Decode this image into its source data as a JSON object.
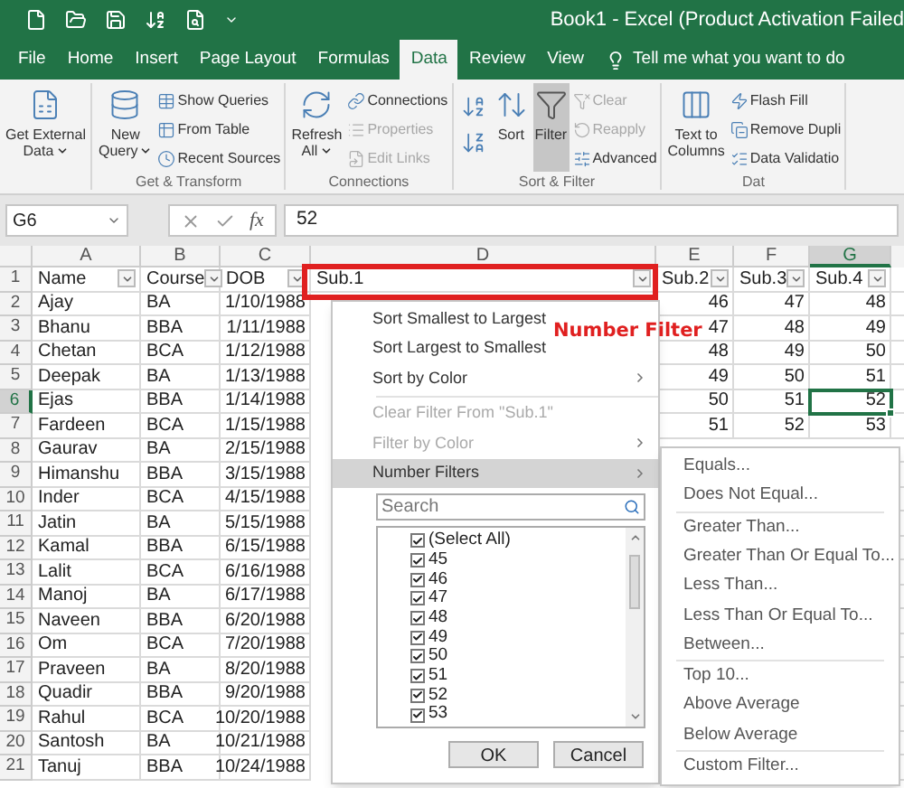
{
  "title_bar": {
    "title": "Book1 - Excel (Product Activation Failed"
  },
  "menu_tabs": [
    {
      "label": "File",
      "selected": false
    },
    {
      "label": "Home",
      "selected": false
    },
    {
      "label": "Insert",
      "selected": false
    },
    {
      "label": "Page Layout",
      "selected": false
    },
    {
      "label": "Formulas",
      "selected": false
    },
    {
      "label": "Data",
      "selected": true
    },
    {
      "label": "Review",
      "selected": false
    },
    {
      "label": "View",
      "selected": false
    }
  ],
  "tell_me": "Tell me what you want to do",
  "ribbon_groups": [
    {
      "items": [
        {
          "kind": "large",
          "lines": [
            "Get External",
            "Data"
          ],
          "dropdown": true,
          "disabled": false,
          "selected": false
        }
      ]
    },
    {
      "label": "Get & Transform",
      "items": [
        {
          "kind": "large",
          "lines": [
            "New",
            "Query"
          ],
          "dropdown": true,
          "disabled": false,
          "selected": false
        },
        {
          "kind": "small",
          "label": "Show Queries",
          "disabled": false
        },
        {
          "kind": "small",
          "label": "From Table",
          "disabled": false
        },
        {
          "kind": "small",
          "label": "Recent Sources",
          "disabled": false
        }
      ]
    },
    {
      "label": "Connections",
      "items": [
        {
          "kind": "large",
          "lines": [
            "Refresh",
            "All"
          ],
          "dropdown": true,
          "disabled": false,
          "selected": false
        },
        {
          "kind": "small",
          "label": "Connections",
          "disabled": false
        },
        {
          "kind": "small",
          "label": "Properties",
          "disabled": true
        },
        {
          "kind": "small",
          "label": "Edit Links",
          "disabled": true
        }
      ]
    },
    {
      "label": "Sort & Filter",
      "items": [
        {
          "kind": "icons"
        },
        {
          "kind": "large",
          "lines": [
            "Sort"
          ],
          "dropdown": false,
          "disabled": false,
          "selected": false
        },
        {
          "kind": "large",
          "lines": [
            "Filter"
          ],
          "dropdown": false,
          "disabled": false,
          "selected": true
        },
        {
          "kind": "small",
          "label": "Clear",
          "disabled": true
        },
        {
          "kind": "small",
          "label": "Reapply",
          "disabled": true
        },
        {
          "kind": "small",
          "label": "Advanced",
          "disabled": false
        }
      ]
    },
    {
      "label": "Dat",
      "items": [
        {
          "kind": "large",
          "lines": [
            "Text to",
            "Columns"
          ],
          "dropdown": false,
          "disabled": false,
          "selected": false
        },
        {
          "kind": "small",
          "label": "Flash Fill",
          "disabled": false
        },
        {
          "kind": "small",
          "label": "Remove Dupli",
          "disabled": false
        },
        {
          "kind": "small",
          "label": "Data Validatio",
          "disabled": false
        }
      ]
    }
  ],
  "formula_bar": {
    "name_box": "G6",
    "function_label": "fx",
    "value": "52"
  },
  "columns": [
    {
      "label": "A",
      "kind": "text",
      "selected": false
    },
    {
      "label": "B",
      "kind": "text",
      "selected": false
    },
    {
      "label": "C",
      "kind": "date",
      "selected": false
    },
    {
      "label": "D",
      "kind": "number",
      "selected": false
    },
    {
      "label": "E",
      "kind": "number",
      "selected": false
    },
    {
      "label": "F",
      "kind": "number",
      "selected": false
    },
    {
      "label": "G",
      "kind": "number",
      "selected": true
    }
  ],
  "rows": [
    {
      "number": "1",
      "kind": "header",
      "selected": false,
      "cells": [
        "Name",
        "Course",
        "DOB",
        "Sub.1",
        "Sub.2",
        "Sub.3",
        "Sub.4"
      ]
    },
    {
      "number": "2",
      "kind": "data",
      "selected": false,
      "cells": [
        "Ajay",
        "BA",
        "1/10/1988",
        null,
        "46",
        "47",
        "48"
      ]
    },
    {
      "number": "3",
      "kind": "data",
      "selected": false,
      "cells": [
        "Bhanu",
        "BBA",
        "1/11/1988",
        null,
        "47",
        "48",
        "49"
      ]
    },
    {
      "number": "4",
      "kind": "data",
      "selected": false,
      "cells": [
        "Chetan",
        "BCA",
        "1/12/1988",
        null,
        "48",
        "49",
        "50"
      ]
    },
    {
      "number": "5",
      "kind": "data",
      "selected": false,
      "cells": [
        "Deepak",
        "BA",
        "1/13/1988",
        null,
        "49",
        "50",
        "51"
      ]
    },
    {
      "number": "6",
      "kind": "data",
      "selected": true,
      "cells": [
        "Ejas",
        "BBA",
        "1/14/1988",
        null,
        "50",
        "51",
        "52"
      ]
    },
    {
      "number": "7",
      "kind": "data",
      "selected": false,
      "cells": [
        "Fardeen",
        "BCA",
        "1/15/1988",
        null,
        "51",
        "52",
        "53"
      ]
    },
    {
      "number": "8",
      "kind": "data",
      "selected": false,
      "cells": [
        "Gaurav",
        "BA",
        "2/15/1988"
      ]
    },
    {
      "number": "9",
      "kind": "data",
      "selected": false,
      "cells": [
        "Himanshu",
        "BBA",
        "3/15/1988"
      ]
    },
    {
      "number": "10",
      "kind": "data",
      "selected": false,
      "cells": [
        "Inder",
        "BCA",
        "4/15/1988"
      ]
    },
    {
      "number": "11",
      "kind": "data",
      "selected": false,
      "cells": [
        "Jatin",
        "BA",
        "5/15/1988"
      ]
    },
    {
      "number": "12",
      "kind": "data",
      "selected": false,
      "cells": [
        "Kamal",
        "BBA",
        "6/15/1988"
      ]
    },
    {
      "number": "13",
      "kind": "data",
      "selected": false,
      "cells": [
        "Lalit",
        "BCA",
        "6/16/1988"
      ]
    },
    {
      "number": "14",
      "kind": "data",
      "selected": false,
      "cells": [
        "Manoj",
        "BA",
        "6/17/1988"
      ]
    },
    {
      "number": "15",
      "kind": "data",
      "selected": false,
      "cells": [
        "Naveen",
        "BBA",
        "6/20/1988"
      ]
    },
    {
      "number": "16",
      "kind": "data",
      "selected": false,
      "cells": [
        "Om",
        "BCA",
        "7/20/1988"
      ]
    },
    {
      "number": "17",
      "kind": "data",
      "selected": false,
      "cells": [
        "Praveen",
        "BA",
        "8/20/1988"
      ]
    },
    {
      "number": "18",
      "kind": "data",
      "selected": false,
      "cells": [
        "Quadir",
        "BBA",
        "9/20/1988"
      ]
    },
    {
      "number": "19",
      "kind": "data",
      "selected": false,
      "cells": [
        "Rahul",
        "BCA",
        "10/20/1988"
      ]
    },
    {
      "number": "20",
      "kind": "data",
      "selected": false,
      "cells": [
        "Santosh",
        "BA",
        "10/21/1988"
      ]
    },
    {
      "number": "21",
      "kind": "data",
      "selected": false,
      "cells": [
        "Tanuj",
        "BBA",
        "10/24/1988"
      ]
    }
  ],
  "filter_menu": {
    "item_groups": [
      [
        {
          "label": "Sort Smallest to Largest",
          "disabled": false,
          "submenu": false,
          "selected": false
        },
        {
          "label": "Sort Largest to Smallest",
          "disabled": false,
          "submenu": false,
          "selected": false
        },
        {
          "label": "Sort by Color",
          "disabled": false,
          "submenu": true,
          "selected": false
        }
      ],
      [
        {
          "label": "Clear Filter From \"Sub.1\"",
          "disabled": true,
          "submenu": false,
          "selected": false
        },
        {
          "label": "Filter by Color",
          "disabled": true,
          "submenu": true,
          "selected": false
        },
        {
          "label": "Number Filters",
          "disabled": false,
          "submenu": true,
          "selected": true
        }
      ]
    ],
    "search": {
      "placeholder": "Search"
    },
    "values": [
      {
        "label": "(Select All)",
        "checked": true
      },
      {
        "label": "45",
        "checked": true
      },
      {
        "label": "46",
        "checked": true
      },
      {
        "label": "47",
        "checked": true
      },
      {
        "label": "48",
        "checked": true
      },
      {
        "label": "49",
        "checked": true
      },
      {
        "label": "50",
        "checked": true
      },
      {
        "label": "51",
        "checked": true
      },
      {
        "label": "52",
        "checked": true
      },
      {
        "label": "53",
        "checked": true
      }
    ],
    "buttons": [
      "OK",
      "Cancel"
    ]
  },
  "number_filters_submenu": [
    [
      "Equals...",
      "Does Not Equal..."
    ],
    [
      "Greater Than...",
      "Greater Than Or Equal To...",
      "Less Than...",
      "Less Than Or Equal To...",
      "Between..."
    ],
    [
      "Top 10...",
      "Above Average",
      "Below Average"
    ],
    [
      "Custom Filter..."
    ]
  ],
  "annotation": {
    "label": "Number Filter"
  }
}
